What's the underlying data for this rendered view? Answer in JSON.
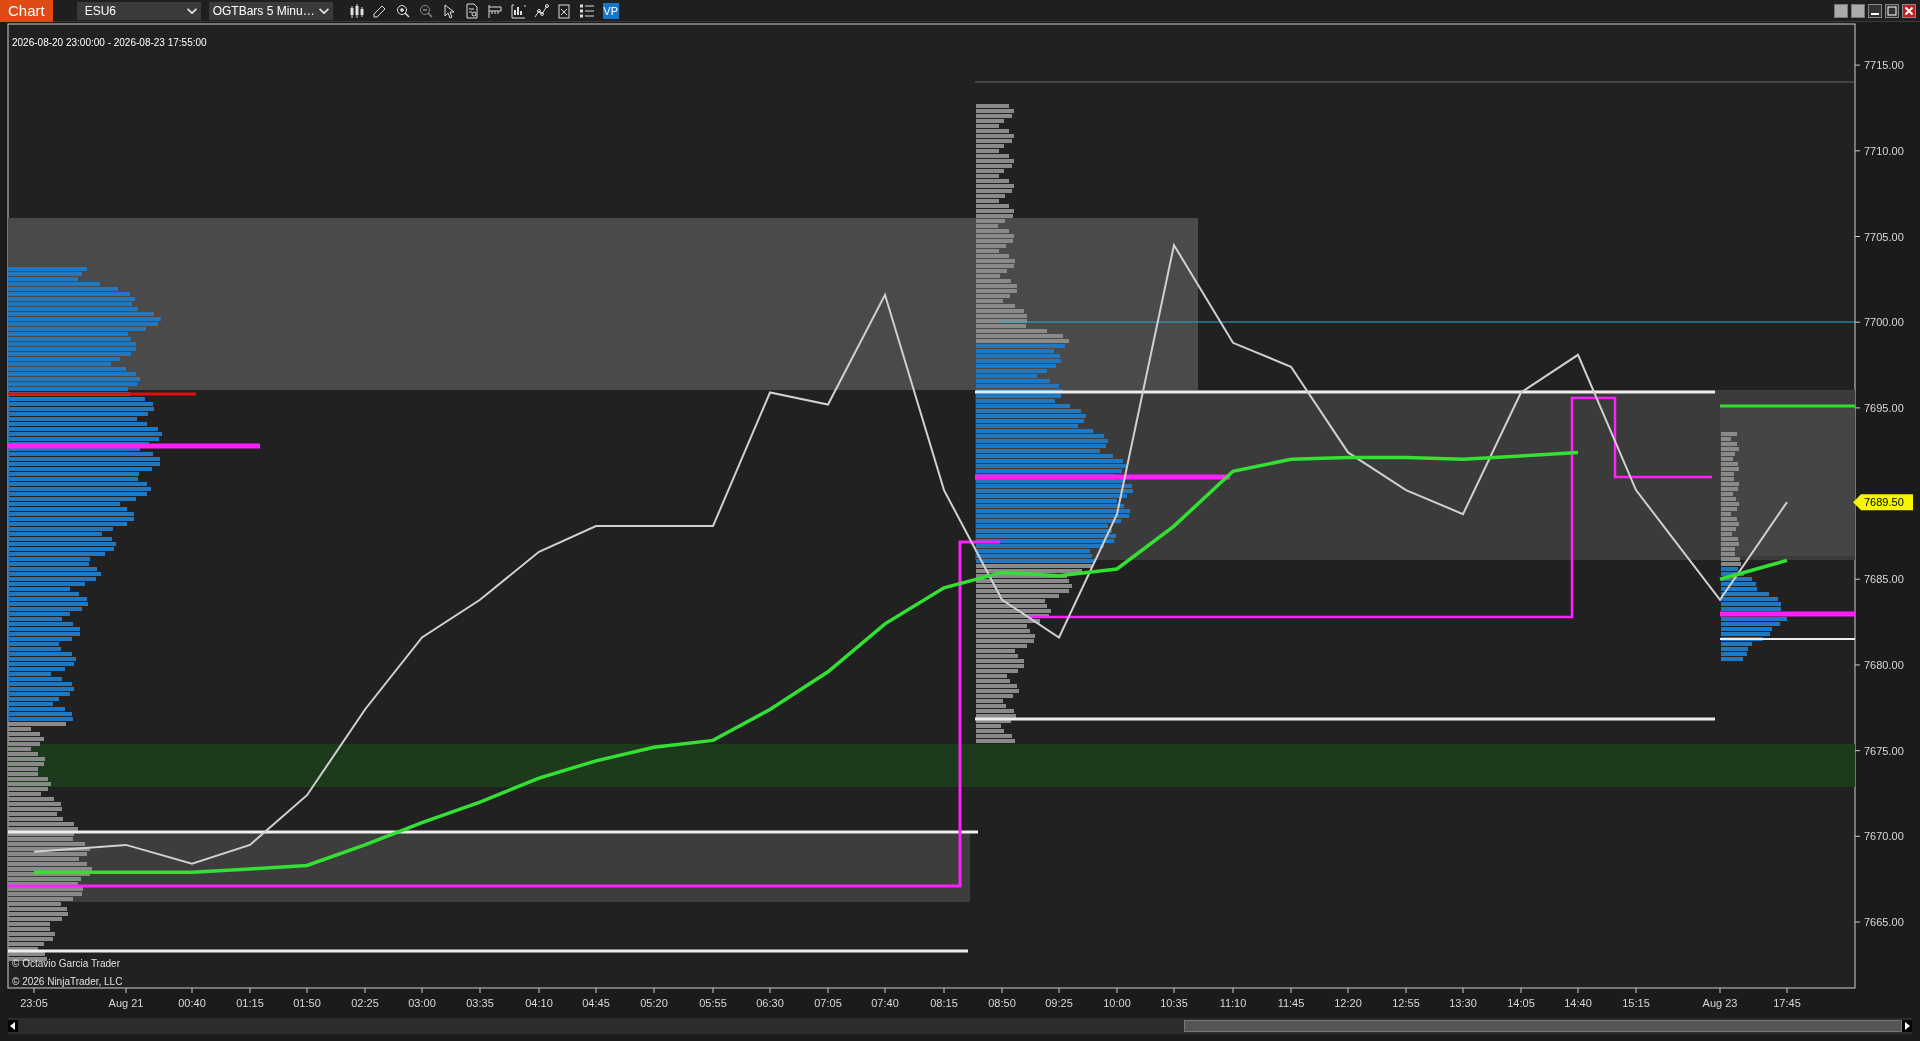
{
  "toolbar": {
    "title": "Chart",
    "instrument": "ESU6",
    "bar_type": "OGTBars 5 Minu…",
    "vp_button": "VP"
  },
  "chart": {
    "date_range": "2026-08-20 23:00:00 - 2026-08-23 17:55:00",
    "price_marker": "7689.50",
    "copyright": [
      "© Octavio Garcia Trader",
      "© 2026 NinjaTrader, LLC"
    ],
    "chart_data": {
      "type": "line",
      "categories": [
        "23:05",
        "Aug 21",
        "00:40",
        "01:15",
        "01:50",
        "02:25",
        "03:00",
        "03:35",
        "04:10",
        "04:45",
        "05:20",
        "05:55",
        "06:30",
        "07:05",
        "07:40",
        "08:15",
        "08:50",
        "09:25",
        "10:00",
        "10:35",
        "11:10",
        "11:45",
        "12:20",
        "12:55",
        "13:30",
        "14:05",
        "14:40",
        "15:15",
        "Aug 23",
        "17:45"
      ],
      "series": [
        {
          "color": "#d0d0d0",
          "values": [
            7669.1,
            7669.5,
            7668.4,
            7669.5,
            7672.4,
            7677.4,
            7681.6,
            7683.8,
            7686.6,
            7688.1,
            7688.1,
            7688.1,
            7695.9,
            7695.2,
            7701.6,
            7690.2,
            7683.8,
            7681.6,
            7688.8,
            7704.5,
            7698.8,
            7697.4,
            7692.4,
            7690.2,
            7688.8,
            7695.9,
            7698.1,
            7690.2,
            7683.8,
            7689.5
          ]
        },
        {
          "color": "#33e033",
          "values": [
            7667.9,
            7667.9,
            7667.9,
            7668.1,
            7668.3,
            7669.5,
            7670.8,
            7672.0,
            7673.4,
            7674.4,
            7675.2,
            7675.6,
            7677.4,
            7679.6,
            7682.4,
            7684.5,
            7685.4,
            7685.2,
            7685.6,
            7688.1,
            7691.3,
            7692.0,
            7692.1,
            7692.1,
            7692.0,
            7692.2,
            7692.4,
            null,
            7685.0,
            7686.1
          ]
        }
      ],
      "ylim": [
        7661.15,
        7717.4
      ],
      "yticks": [
        {
          "value": 7665,
          "label": "7665.00"
        },
        {
          "value": 7670,
          "label": "7670.00"
        },
        {
          "value": 7675,
          "label": "7675.00"
        },
        {
          "value": 7680,
          "label": "7680.00"
        },
        {
          "value": 7685,
          "label": "7685.00"
        },
        {
          "value": 7695,
          "label": "7695.00"
        },
        {
          "value": 7700,
          "label": "7700.00"
        },
        {
          "value": 7705,
          "label": "7705.00"
        },
        {
          "value": 7710,
          "label": "7710.00"
        },
        {
          "value": 7715,
          "label": "7715.00"
        }
      ]
    }
  }
}
